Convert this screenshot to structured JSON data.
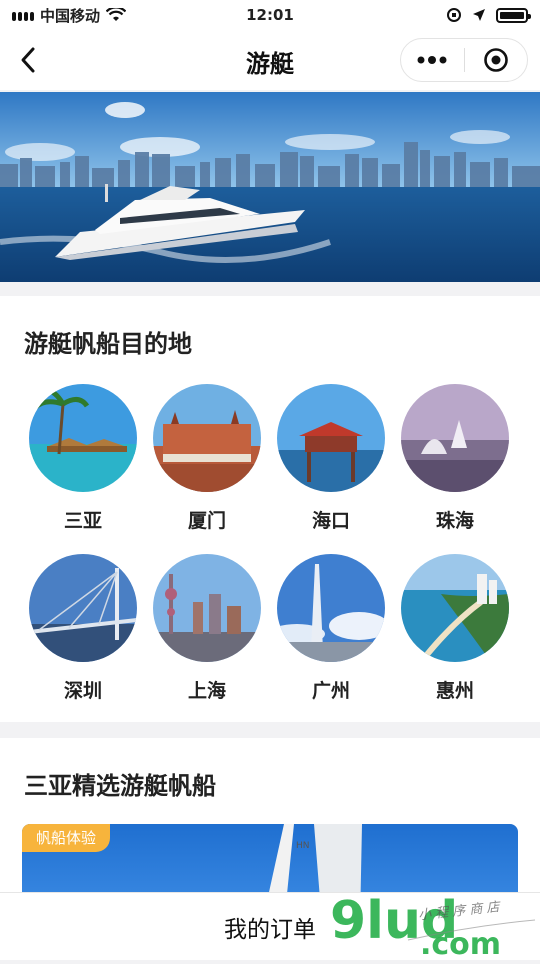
{
  "status_bar": {
    "carrier": "中国移动",
    "time": "12:01"
  },
  "nav": {
    "title": "游艇"
  },
  "destinations_section": {
    "title": "游艇帆船目的地",
    "items": [
      {
        "label": "三亚"
      },
      {
        "label": "厦门"
      },
      {
        "label": "海口"
      },
      {
        "label": "珠海"
      },
      {
        "label": "深圳"
      },
      {
        "label": "上海"
      },
      {
        "label": "广州"
      },
      {
        "label": "惠州"
      }
    ]
  },
  "featured_section": {
    "title": "三亚精选游艇帆船",
    "badge": "帆船体验"
  },
  "bottom_bar": {
    "label": "我的订单"
  },
  "watermark": {
    "brand": "91ud.com",
    "tagline": "小程序商店"
  },
  "colors": {
    "badge": "#f7b43c",
    "background": "#f2f2f4",
    "watermark_green": "#27b04b"
  }
}
